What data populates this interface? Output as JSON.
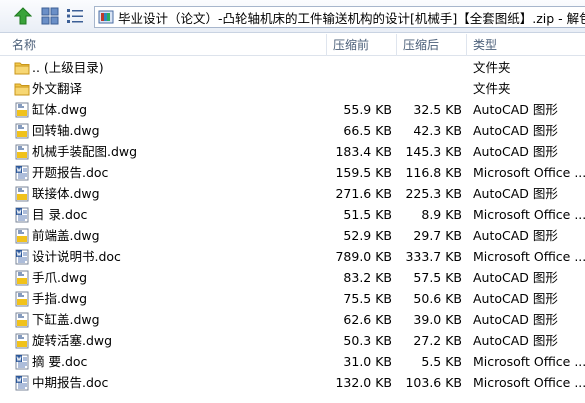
{
  "address": {
    "path": "毕业设计（论文）-凸轮轴机床的工件输送机构的设计[机械手]【全套图纸】.zip - 解包大小"
  },
  "columns": {
    "name": "名称",
    "size": "压缩前",
    "compressed": "压缩后",
    "type": "类型"
  },
  "files": [
    {
      "name": ".. (上级目录)",
      "size": "",
      "compressed": "",
      "type": "文件夹",
      "icon": "folder-icon"
    },
    {
      "name": "外文翻译",
      "size": "",
      "compressed": "",
      "type": "文件夹",
      "icon": "folder-icon"
    },
    {
      "name": "缸体.dwg",
      "size": "55.9 KB",
      "compressed": "32.5 KB",
      "type": "AutoCAD 图形",
      "icon": "dwg-file-icon"
    },
    {
      "name": "回转轴.dwg",
      "size": "66.5 KB",
      "compressed": "42.3 KB",
      "type": "AutoCAD 图形",
      "icon": "dwg-file-icon"
    },
    {
      "name": "机械手装配图.dwg",
      "size": "183.4 KB",
      "compressed": "145.3 KB",
      "type": "AutoCAD 图形",
      "icon": "dwg-file-icon"
    },
    {
      "name": "开题报告.doc",
      "size": "159.5 KB",
      "compressed": "116.8 KB",
      "type": "Microsoft Office ...",
      "icon": "doc-file-icon"
    },
    {
      "name": "联接体.dwg",
      "size": "271.6 KB",
      "compressed": "225.3 KB",
      "type": "AutoCAD 图形",
      "icon": "dwg-file-icon"
    },
    {
      "name": "目  录.doc",
      "size": "51.5 KB",
      "compressed": "8.9 KB",
      "type": "Microsoft Office ...",
      "icon": "doc-file-icon"
    },
    {
      "name": "前端盖.dwg",
      "size": "52.9 KB",
      "compressed": "29.7 KB",
      "type": "AutoCAD 图形",
      "icon": "dwg-file-icon"
    },
    {
      "name": "设计说明书.doc",
      "size": "789.0 KB",
      "compressed": "333.7 KB",
      "type": "Microsoft Office ...",
      "icon": "doc-file-icon"
    },
    {
      "name": "手爪.dwg",
      "size": "83.2 KB",
      "compressed": "57.5 KB",
      "type": "AutoCAD 图形",
      "icon": "dwg-file-icon"
    },
    {
      "name": "手指.dwg",
      "size": "75.5 KB",
      "compressed": "50.6 KB",
      "type": "AutoCAD 图形",
      "icon": "dwg-file-icon"
    },
    {
      "name": "下缸盖.dwg",
      "size": "62.6 KB",
      "compressed": "39.0 KB",
      "type": "AutoCAD 图形",
      "icon": "dwg-file-icon"
    },
    {
      "name": "旋转活塞.dwg",
      "size": "50.3 KB",
      "compressed": "27.2 KB",
      "type": "AutoCAD 图形",
      "icon": "dwg-file-icon"
    },
    {
      "name": "摘 要.doc",
      "size": "31.0 KB",
      "compressed": "5.5 KB",
      "type": "Microsoft Office ...",
      "icon": "doc-file-icon"
    },
    {
      "name": "中期报告.doc",
      "size": "132.0 KB",
      "compressed": "103.6 KB",
      "type": "Microsoft Office ...",
      "icon": "doc-file-icon"
    }
  ]
}
